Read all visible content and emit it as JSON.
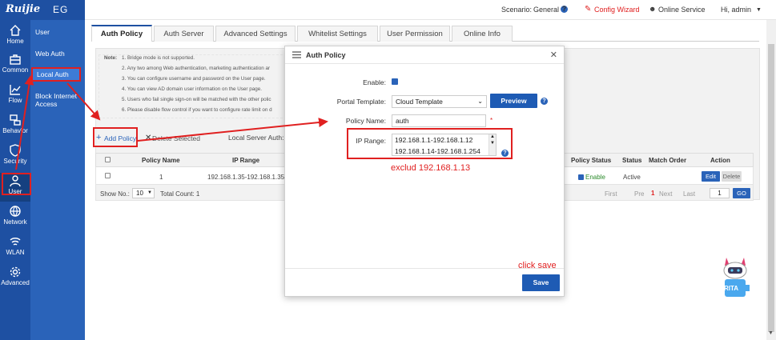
{
  "brand": {
    "name": "Ruijie",
    "product": "EG"
  },
  "header": {
    "scenario_label": "Scenario:",
    "scenario_value": "General",
    "config_wizard": "Config Wizard",
    "online_service": "Online Service",
    "greeting": "Hi, admin"
  },
  "nav": {
    "items": [
      {
        "label": "Home",
        "icon": "home-icon"
      },
      {
        "label": "Common",
        "icon": "toolbox-icon"
      },
      {
        "label": "Flow",
        "icon": "chart-icon"
      },
      {
        "label": "Behavior",
        "icon": "behavior-icon"
      },
      {
        "label": "Security",
        "icon": "shield-icon"
      },
      {
        "label": "User",
        "icon": "user-icon"
      },
      {
        "label": "Network",
        "icon": "globe-icon"
      },
      {
        "label": "WLAN",
        "icon": "wifi-icon"
      },
      {
        "label": "Advanced",
        "icon": "gear-icon"
      }
    ]
  },
  "subnav": {
    "items": [
      {
        "label": "User"
      },
      {
        "label": "Web Auth"
      },
      {
        "label": "Local Auth"
      },
      {
        "label": "Block Internet Access"
      }
    ]
  },
  "tabs": [
    "Auth Policy",
    "Auth Server",
    "Advanced Settings",
    "Whitelist Settings",
    "User Permission",
    "Online Info"
  ],
  "notes": {
    "prefix": "Note:",
    "lines": [
      "1. Bridge mode is not supported.",
      "2. Any two among Web authentication, marketing authentication ar",
      "3. You can configure username and password on the User page.",
      "4. You can view AD domain user information on the User page.",
      "5. Users who fail single sign-on will be matched with the other polic",
      "6. Please disable flow control if you want to configure rate limit on d"
    ]
  },
  "toolbar": {
    "add_policy": "Add Policy",
    "delete_selected": "Delete Selected",
    "local_server_auth": "Local Server Auth:"
  },
  "table": {
    "headers": {
      "policy_name": "Policy Name",
      "ip_range": "IP Range",
      "policy_status": "Policy Status",
      "status": "Status",
      "match_order": "Match Order",
      "action": "Action"
    },
    "rows": [
      {
        "policy_name": "1",
        "ip_range": "192.168.1.35-192.168.1.35",
        "policy_status": "Enable",
        "status": "Active",
        "edit": "Edit",
        "delete": "Delete"
      }
    ]
  },
  "pager": {
    "show_no": "Show No.:",
    "page_size": "10",
    "total": "Total Count: 1",
    "first": "First",
    "prev": "Pre",
    "current": "1",
    "next": "Next",
    "last": "Last",
    "page_input": "1",
    "go": "GO"
  },
  "dialog": {
    "title": "Auth Policy",
    "enable_label": "Enable:",
    "portal_template_label": "Portal Template:",
    "portal_template_value": "Cloud Template",
    "preview": "Preview",
    "policy_name_label": "Policy Name:",
    "policy_name_value": "auth",
    "required_mark": "*",
    "ip_range_label": "IP Range:",
    "ip_range_lines": [
      "192.168.1.1-192.168.1.12",
      "192.168.1.14-192.168.1.254"
    ],
    "save": "Save"
  },
  "annotations": {
    "exclude": "exclud 192.168.1.13",
    "click_save": "click save"
  },
  "mascot_label": "RITA",
  "colors": {
    "nav": "#1e50a2",
    "subnav": "#2a63b9",
    "accent": "#1e5bb4",
    "annotation": "#e02020"
  }
}
